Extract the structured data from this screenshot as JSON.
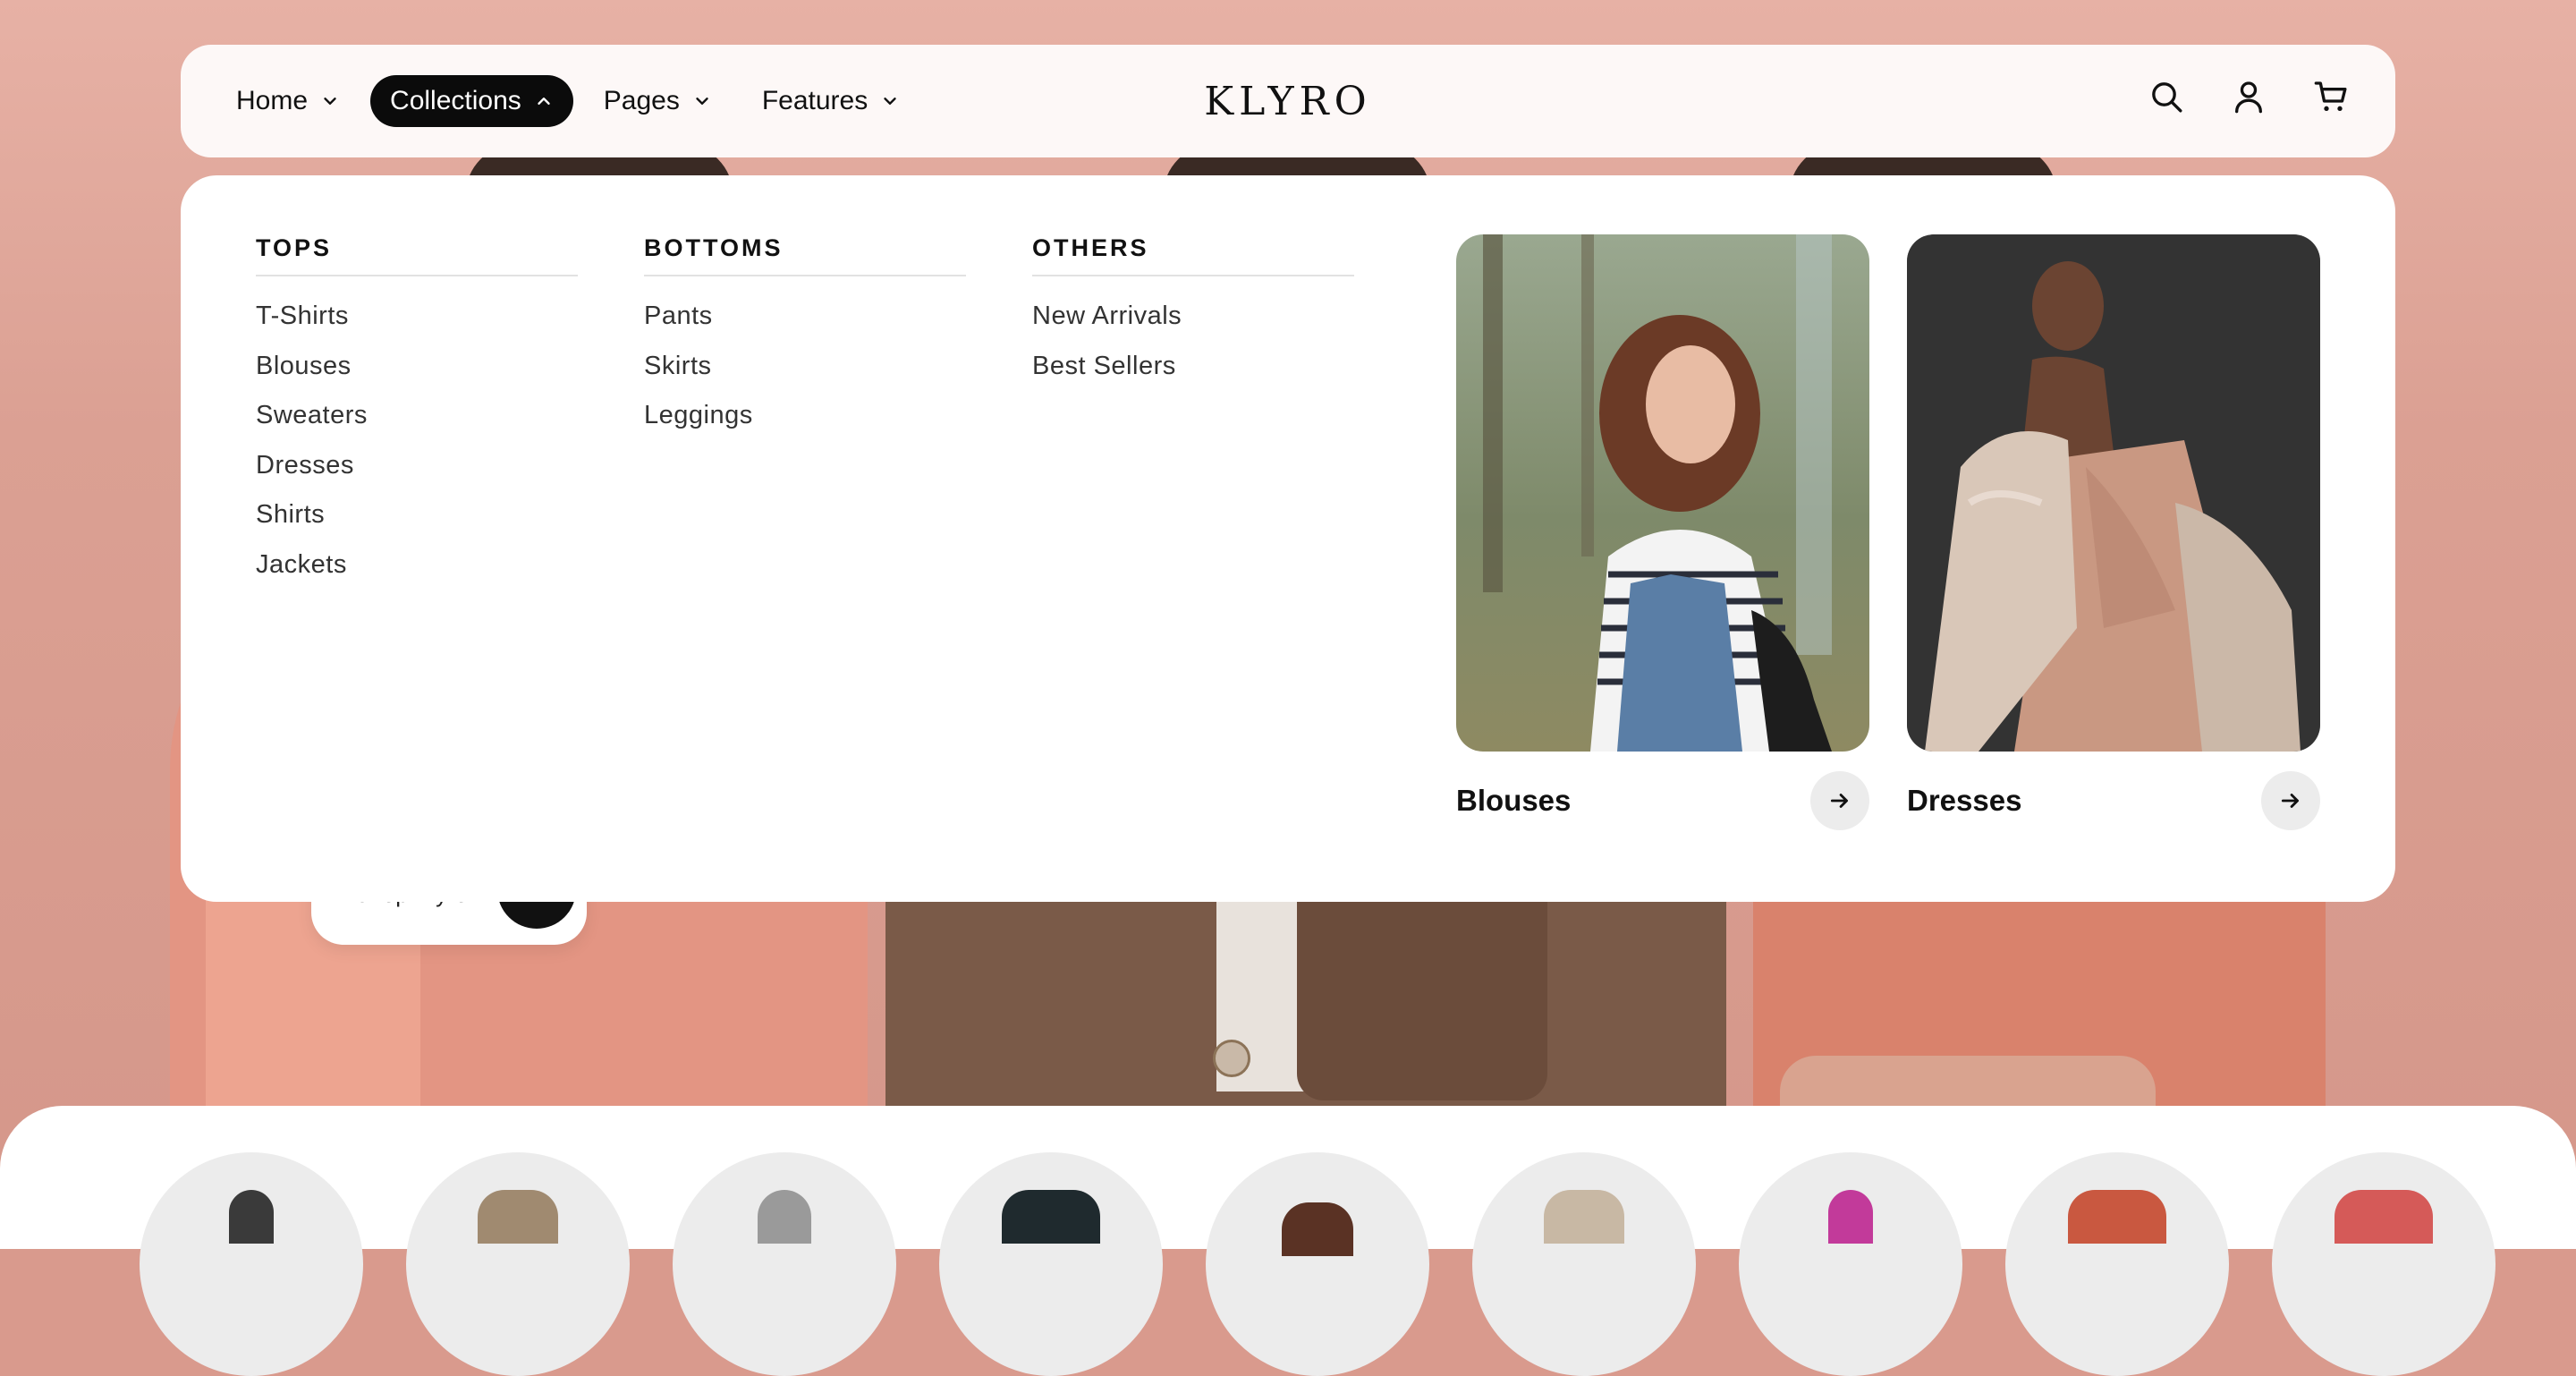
{
  "brand": {
    "logo": "KLYRO"
  },
  "nav": {
    "items": [
      {
        "label": "Home",
        "icon": "chevron-down-icon",
        "active": false
      },
      {
        "label": "Collections",
        "icon": "chevron-up-icon",
        "active": true
      },
      {
        "label": "Pages",
        "icon": "chevron-down-icon",
        "active": false
      },
      {
        "label": "Features",
        "icon": "chevron-down-icon",
        "active": false
      }
    ]
  },
  "header_icons": [
    "search-icon",
    "account-icon",
    "cart-icon"
  ],
  "mega_menu": {
    "columns": [
      {
        "title": "TOPS",
        "links": [
          "T-Shirts",
          "Blouses",
          "Sweaters",
          "Dresses",
          "Shirts",
          "Jackets"
        ]
      },
      {
        "title": "BOTTOMS",
        "links": [
          "Pants",
          "Skirts",
          "Leggings"
        ]
      },
      {
        "title": "OTHERS",
        "links": [
          "New Arrivals",
          "Best Sellers"
        ]
      }
    ],
    "cards": [
      {
        "caption": "Blouses",
        "icon": "arrow-right-icon"
      },
      {
        "caption": "Dresses",
        "icon": "arrow-right-icon"
      }
    ]
  },
  "hero": {
    "shop_button_label": "Shop Klyro"
  },
  "colors": {
    "background": "#d99a8d",
    "active_nav": "#0b0b0b",
    "panel": "#ffffff"
  }
}
